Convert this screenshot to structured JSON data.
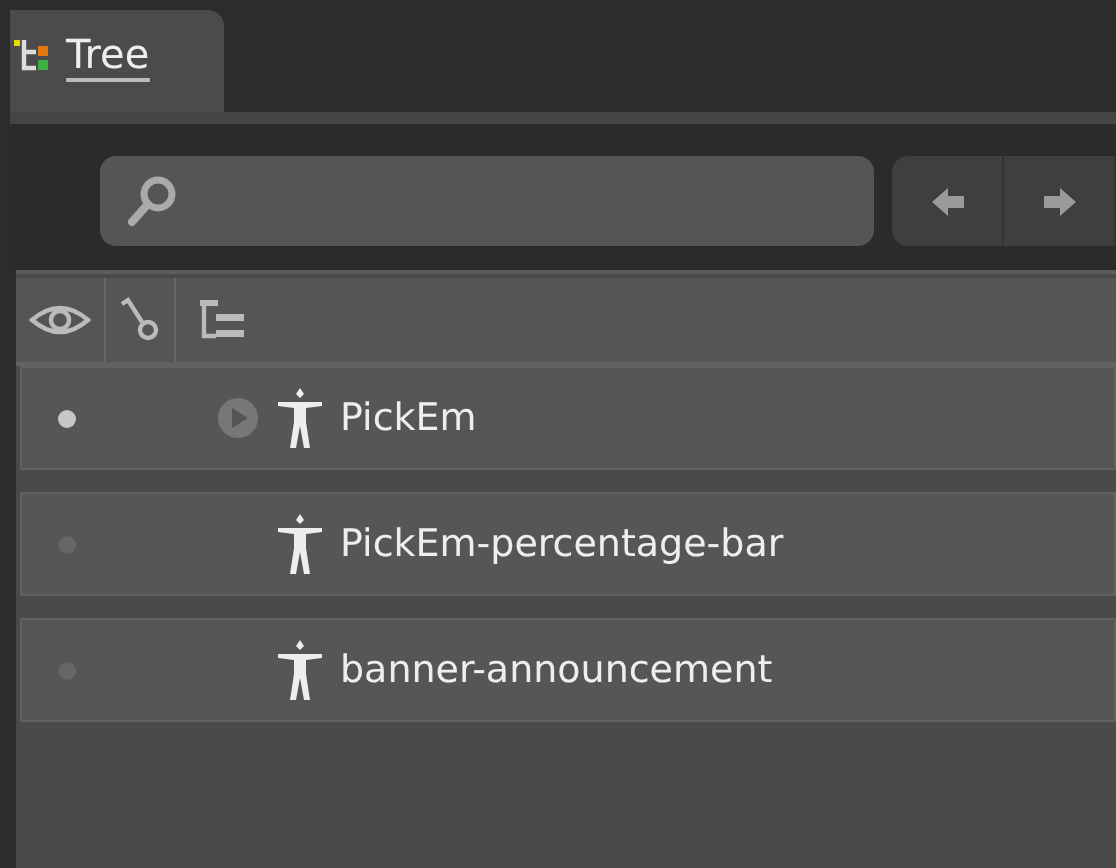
{
  "tabs": [
    {
      "label": "Tree",
      "selected": true
    }
  ],
  "rows": [
    {
      "name": "PickEm",
      "visible": true,
      "kind": "group"
    },
    {
      "name": "PickEm-percentage-bar",
      "visible": false,
      "kind": "leaf"
    },
    {
      "name": "banner-announcement",
      "visible": false,
      "kind": "leaf"
    }
  ]
}
